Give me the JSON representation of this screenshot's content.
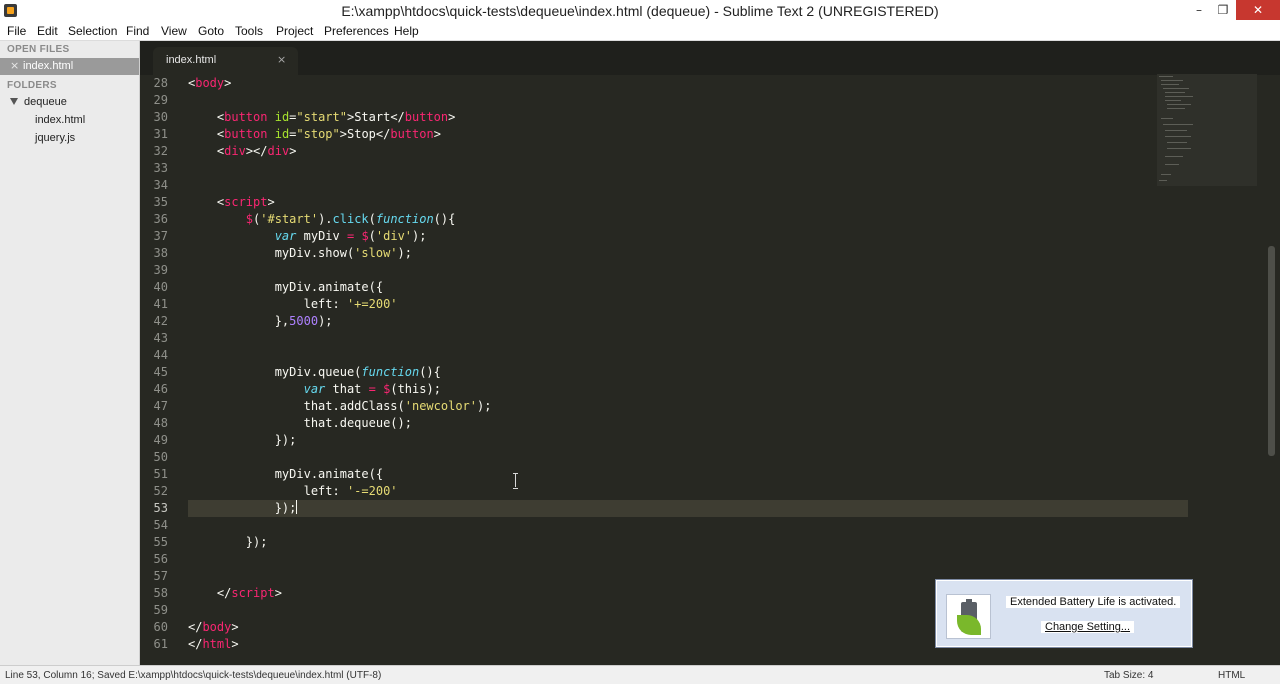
{
  "window": {
    "title": "E:\\xampp\\htdocs\\quick-tests\\dequeue\\index.html (dequeue) - Sublime Text 2 (UNREGISTERED)",
    "minimize": "–",
    "maximize": "❐",
    "close": "✕"
  },
  "menu": [
    "File",
    "Edit",
    "Selection",
    "Find",
    "View",
    "Goto",
    "Tools",
    "Project",
    "Preferences",
    "Help"
  ],
  "sidebar": {
    "open_files_header": "OPEN FILES",
    "open_file": "index.html",
    "close_glyph": "×",
    "folders_header": "FOLDERS",
    "folder": "dequeue",
    "files": [
      "index.html",
      "jquery.js"
    ]
  },
  "tab": {
    "label": "index.html",
    "close_glyph": "×"
  },
  "editor": {
    "line_numbers": [
      "28",
      "29",
      "30",
      "31",
      "32",
      "33",
      "34",
      "35",
      "36",
      "37",
      "38",
      "39",
      "40",
      "41",
      "42",
      "43",
      "44",
      "45",
      "46",
      "47",
      "48",
      "49",
      "50",
      "51",
      "52",
      "53",
      "54",
      "55",
      "56",
      "57",
      "58",
      "59",
      "60",
      "61"
    ],
    "current_line": "53"
  },
  "notification": {
    "title": "Extended Battery Life is activated.",
    "link": "Change Setting..."
  },
  "status": {
    "left": "Line 53, Column 16; Saved E:\\xampp\\htdocs\\quick-tests\\dequeue\\index.html (UTF-8)",
    "tab_size": "Tab Size: 4",
    "syntax": "HTML"
  },
  "colors": {
    "editor_bg": "#272822",
    "tag": "#f92672",
    "attribute": "#a6e22e",
    "string": "#e6db74",
    "function": "#66d9ef",
    "number": "#ae81ff"
  }
}
